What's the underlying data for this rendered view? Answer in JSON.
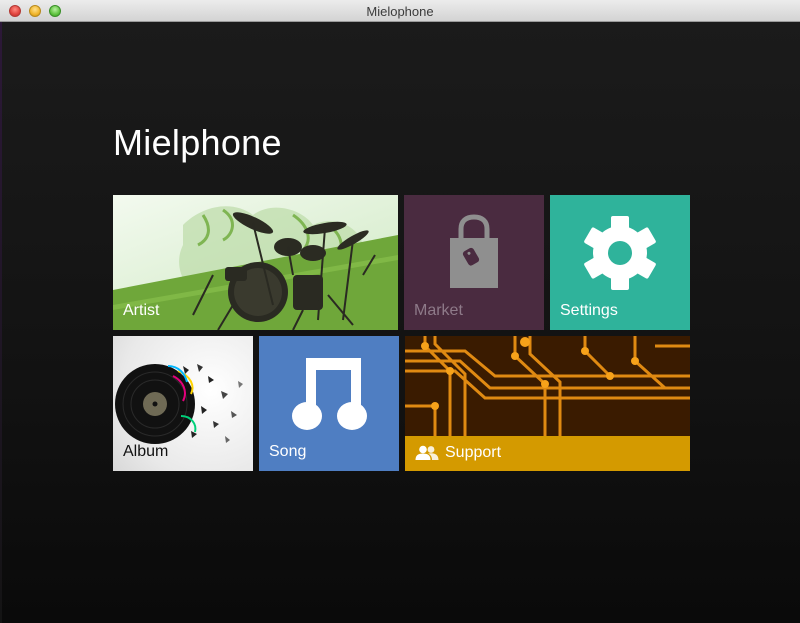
{
  "window": {
    "title": "Mielophone"
  },
  "app": {
    "title": "Mielphone"
  },
  "tiles": {
    "artist": {
      "label": "Artist",
      "icon": "drum-kit-icon"
    },
    "market": {
      "label": "Market",
      "icon": "shopping-bag-icon"
    },
    "settings": {
      "label": "Settings",
      "icon": "gear-icon"
    },
    "album": {
      "label": "Album",
      "icon": "vinyl-record-icon"
    },
    "song": {
      "label": "Song",
      "icon": "music-note-icon"
    },
    "support": {
      "label": "Support",
      "icon": "users-icon"
    }
  },
  "colors": {
    "market": "#4a2b40",
    "settings": "#2fb39b",
    "song": "#4f7ec2",
    "support": "#d49a00",
    "artist_green": "#6fa73a"
  }
}
